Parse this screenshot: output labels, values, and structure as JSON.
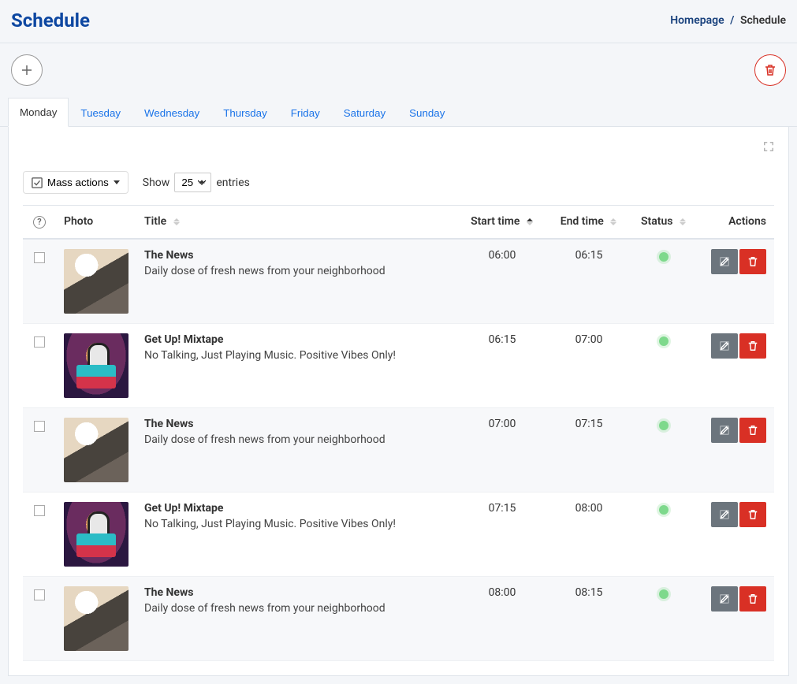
{
  "header": {
    "title": "Schedule",
    "breadcrumb": {
      "home": "Homepage",
      "current": "Schedule"
    }
  },
  "tabs": [
    {
      "label": "Monday",
      "active": true
    },
    {
      "label": "Tuesday",
      "active": false
    },
    {
      "label": "Wednesday",
      "active": false
    },
    {
      "label": "Thursday",
      "active": false
    },
    {
      "label": "Friday",
      "active": false
    },
    {
      "label": "Saturday",
      "active": false
    },
    {
      "label": "Sunday",
      "active": false
    }
  ],
  "controls": {
    "mass_actions_label": "Mass actions",
    "show_label": "Show",
    "entries_label": "entries",
    "page_size": "25"
  },
  "columns": {
    "photo": "Photo",
    "title": "Title",
    "start": "Start time",
    "end": "End time",
    "status": "Status",
    "actions": "Actions"
  },
  "rows": [
    {
      "title": "The News",
      "desc": "Daily dose of fresh news from your neighborhood",
      "start": "06:00",
      "end": "06:15",
      "status": "active",
      "kind": "news"
    },
    {
      "title": "Get Up! Mixtape",
      "desc": "No Talking, Just Playing Music. Positive Vibes Only!",
      "start": "06:15",
      "end": "07:00",
      "status": "active",
      "kind": "mixtape"
    },
    {
      "title": "The News",
      "desc": "Daily dose of fresh news from your neighborhood",
      "start": "07:00",
      "end": "07:15",
      "status": "active",
      "kind": "news"
    },
    {
      "title": "Get Up! Mixtape",
      "desc": "No Talking, Just Playing Music. Positive Vibes Only!",
      "start": "07:15",
      "end": "08:00",
      "status": "active",
      "kind": "mixtape"
    },
    {
      "title": "The News",
      "desc": "Daily dose of fresh news from your neighborhood",
      "start": "08:00",
      "end": "08:15",
      "status": "active",
      "kind": "news"
    }
  ]
}
